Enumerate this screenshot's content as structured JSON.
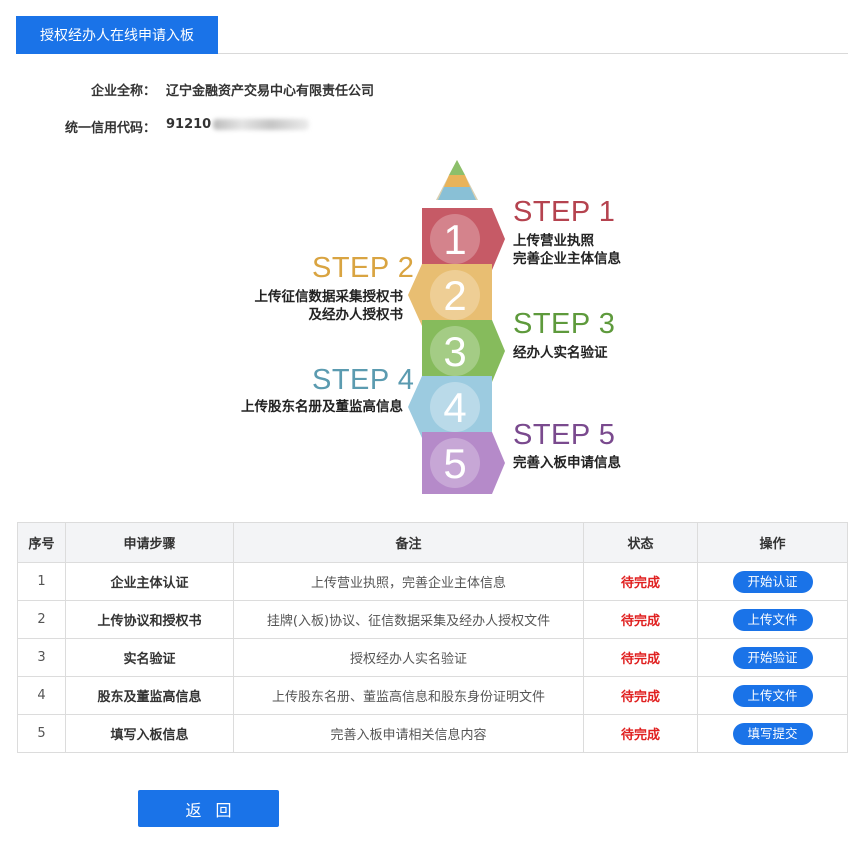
{
  "tab": {
    "label": "授权经办人在线申请入板"
  },
  "company": {
    "name_label": "企业全称：",
    "name_value": "辽宁金融资产交易中心有限责任公司",
    "credit_label": "统一信用代码：",
    "credit_value": "91210"
  },
  "steps": [
    {
      "num": "1",
      "title": "STEP 1",
      "lines": [
        "上传营业执照",
        "完善企业主体信息"
      ]
    },
    {
      "num": "2",
      "title": "STEP 2",
      "lines": [
        "上传征信数据采集授权书",
        "及经办人授权书"
      ]
    },
    {
      "num": "3",
      "title": "STEP 3",
      "lines": [
        "经办人实名验证"
      ]
    },
    {
      "num": "4",
      "title": "STEP 4",
      "lines": [
        "上传股东名册及董监高信息"
      ]
    },
    {
      "num": "5",
      "title": "STEP 5",
      "lines": [
        "完善入板申请信息"
      ]
    }
  ],
  "table": {
    "headers": [
      "序号",
      "申请步骤",
      "备注",
      "状态",
      "操作"
    ],
    "rows": [
      {
        "no": "1",
        "step": "企业主体认证",
        "note": "上传营业执照，完善企业主体信息",
        "status": "待完成",
        "action": "开始认证"
      },
      {
        "no": "2",
        "step": "上传协议和授权书",
        "note": "挂牌(入板)协议、征信数据采集及经办人授权文件",
        "status": "待完成",
        "action": "上传文件"
      },
      {
        "no": "3",
        "step": "实名验证",
        "note": "授权经办人实名验证",
        "status": "待完成",
        "action": "开始验证"
      },
      {
        "no": "4",
        "step": "股东及董监高信息",
        "note": "上传股东名册、董监高信息和股东身份证明文件",
        "status": "待完成",
        "action": "上传文件"
      },
      {
        "no": "5",
        "step": "填写入板信息",
        "note": "完善入板申请相关信息内容",
        "status": "待完成",
        "action": "填写提交"
      }
    ]
  },
  "back_button": {
    "label": "返回"
  },
  "colors": {
    "primary": "#1a73e8",
    "status_pending": "#e02020",
    "step1": "#b5434f",
    "step2": "#d9a441",
    "step3": "#5e9a3c",
    "step4": "#5b9bb0",
    "step5": "#7a4a8e"
  }
}
